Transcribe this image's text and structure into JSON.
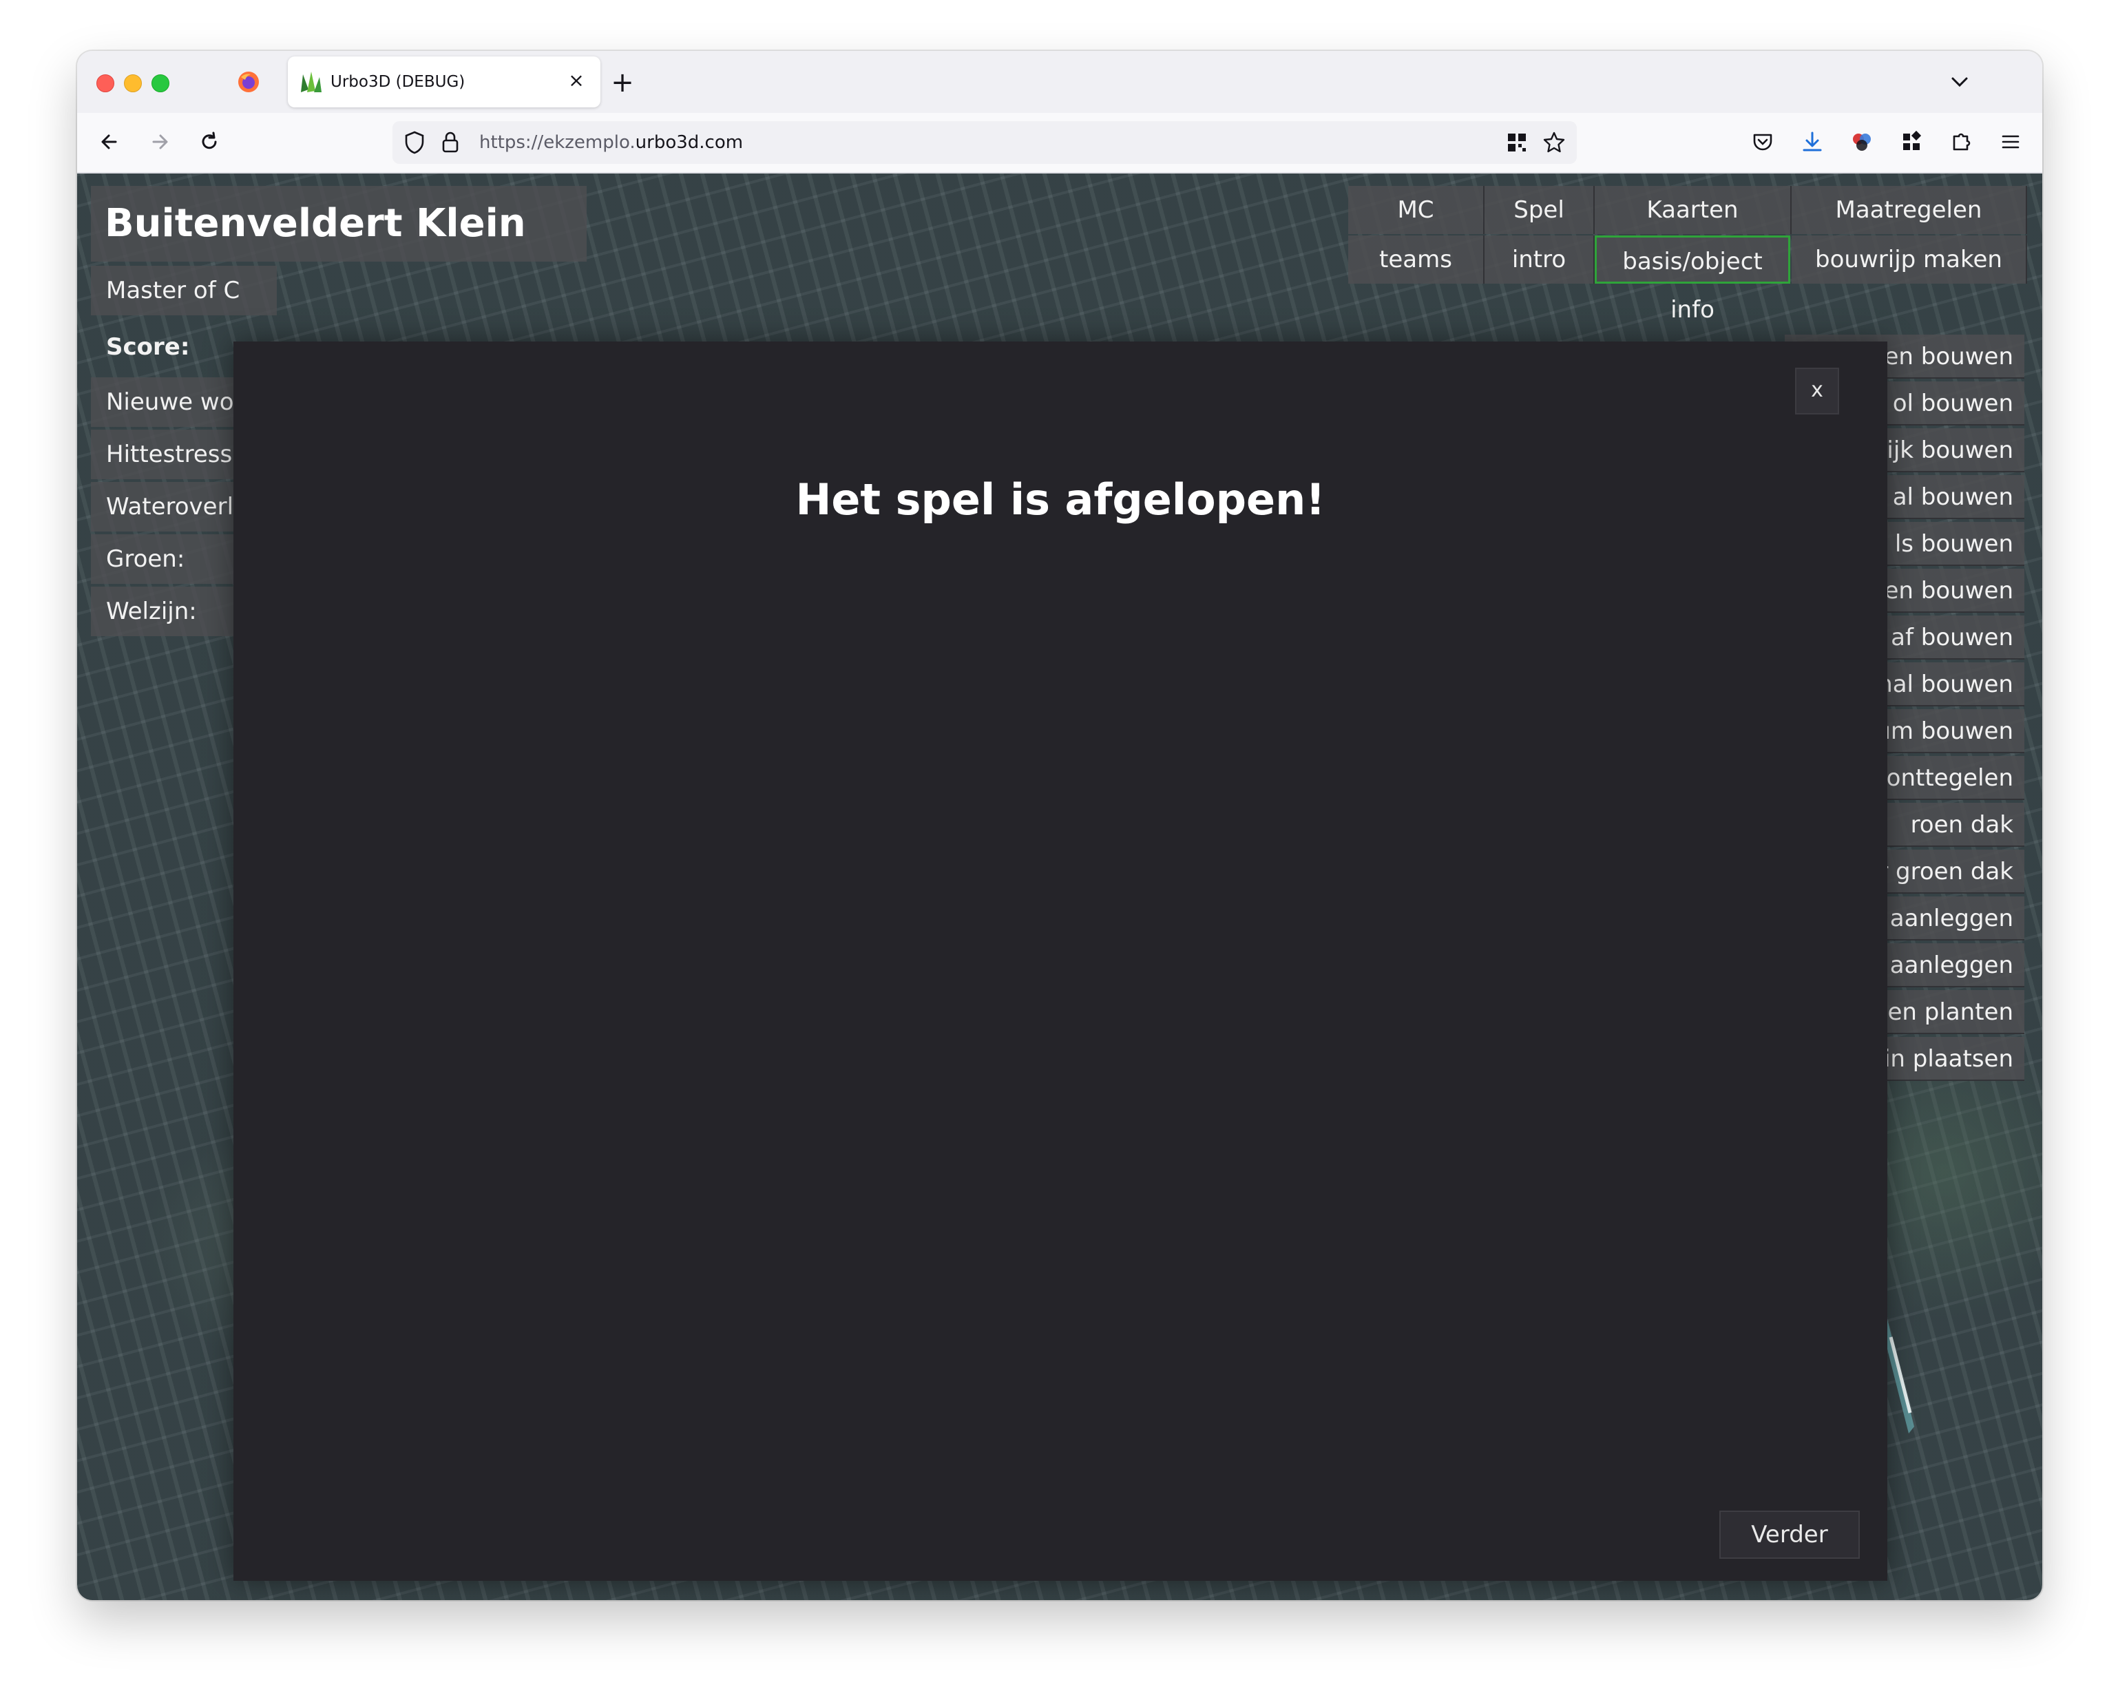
{
  "browser": {
    "tab_title": "Urbo3D (DEBUG)",
    "tab_close": "×",
    "new_tab": "+",
    "url_prefix": "https://ekzemplo.",
    "url_host": "urbo3d.com"
  },
  "app": {
    "title": "Buitenveldert Klein",
    "sidebar": [
      {
        "label": "Master of C"
      },
      {
        "label": "Score:"
      },
      {
        "label": "Nieuwe won"
      },
      {
        "label": "Hittestress:"
      },
      {
        "label": "Wateroverla"
      },
      {
        "label": "Groen:"
      },
      {
        "label": "Welzijn:"
      }
    ],
    "menu_heads": [
      "MC",
      "Spel",
      "Kaarten",
      "Maatregelen"
    ],
    "menu_subs": [
      "teams",
      "intro",
      "basis/object info",
      "bouwrijp maken"
    ],
    "maatregelen": [
      "en bouwen",
      "ol bouwen",
      "aktijk bouwen",
      "al bouwen",
      "ls bouwen",
      "en bouwen",
      "af bouwen",
      "hal bouwen",
      "trum bouwen",
      "onttegelen",
      "roen dak",
      "er groen dak",
      "aanleggen",
      "n aanleggen",
      "en planten",
      "in plaatsen"
    ]
  },
  "modal": {
    "close_label": "x",
    "title": "Het spel is afgelopen!",
    "button_label": "Verder"
  }
}
